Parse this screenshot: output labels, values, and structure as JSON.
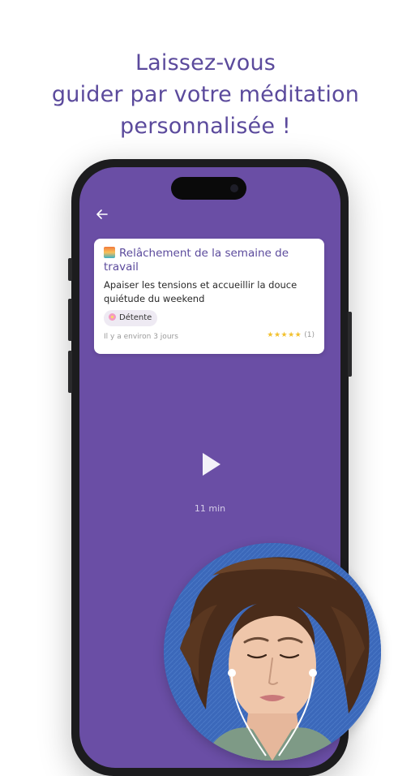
{
  "headline": {
    "line1": "Laissez-vous",
    "line2": "guider par votre méditation",
    "line3": "personnalisée !"
  },
  "colors": {
    "headline": "#5b4a9c",
    "screen_background": "#6a4ea5",
    "card_background": "#ffffff",
    "stars": "#f2c12e"
  },
  "screen": {
    "back_icon": "arrow-left-icon",
    "card": {
      "emoji_icon": "sunrise-emoji-icon",
      "title": "Relâchement de la semaine de travail",
      "description": "Apaiser les tensions et accueillir la douce quiétude du weekend",
      "tag": {
        "icon": "flower-icon",
        "label": "Détente"
      },
      "timestamp": "Il y a environ 3 jours",
      "rating": {
        "stars": "★★★★★",
        "count": "(1)"
      }
    },
    "play_icon": "play-icon",
    "duration": "11 min"
  },
  "photo": {
    "subject": "woman-with-earphones"
  }
}
